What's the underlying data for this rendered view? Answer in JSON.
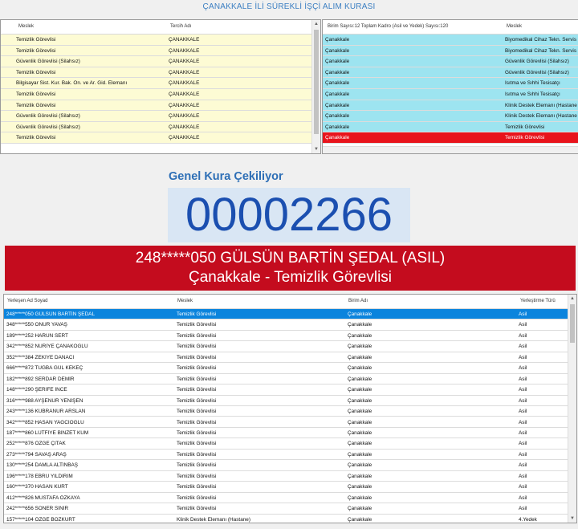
{
  "window": {
    "title": "ÇANAKKALE İLİ SÜREKLİ İŞÇİ ALIM KURASI"
  },
  "top_left_grid": {
    "columns": [
      "Meslek",
      "Tercih Adı"
    ],
    "rows": [
      [
        "Temizlik Görevlisi",
        "ÇANAKKALE"
      ],
      [
        "Temizlik Görevlisi",
        "ÇANAKKALE"
      ],
      [
        "Güvenlik Görevlisi (Silahsız)",
        "ÇANAKKALE"
      ],
      [
        "Temizlik Görevlisi",
        "ÇANAKKALE"
      ],
      [
        "Bilgisayar Sist. Kur. Bak. On. ve Ar. Gid. Elemanı",
        "ÇANAKKALE"
      ],
      [
        "Temizlik Görevlisi",
        "ÇANAKKALE"
      ],
      [
        "Temizlik Görevlisi",
        "ÇANAKKALE"
      ],
      [
        "Güvenlik Görevlisi (Silahsız)",
        "ÇANAKKALE"
      ],
      [
        "Güvenlik Görevlisi (Silahsız)",
        "ÇANAKKALE"
      ],
      [
        "Temizlik Görevlisi",
        "ÇANAKKALE"
      ]
    ]
  },
  "top_right_grid": {
    "columns": [
      "Birim Sayısı:12 Toplam Kadro (Asil ve Yedek) Sayısı:120",
      "Meslek"
    ],
    "rows": [
      [
        "Çanakkale",
        "Biyomedikal Cihaz Tekn. Servis"
      ],
      [
        "Çanakkale",
        "Biyomedikal Cihaz Tekn. Servis"
      ],
      [
        "Çanakkale",
        "Güvenlik Görevlisi (Silahsız)"
      ],
      [
        "Çanakkale",
        "Güvenlik Görevlisi (Silahsız)"
      ],
      [
        "Çanakkale",
        "Isıtma ve Sıhhi Tesisatçı"
      ],
      [
        "Çanakkale",
        "Isıtma ve Sıhhi Tesisatçı"
      ],
      [
        "Çanakkale",
        "Klinik Destek Elemanı (Hastane"
      ],
      [
        "Çanakkale",
        "Klinik Destek Elemanı (Hastane"
      ],
      [
        "Çanakkale",
        "Temizlik Görevlisi"
      ],
      [
        "Çanakkale",
        "Temizlik Görevlisi"
      ]
    ],
    "selected_row": 9
  },
  "draw": {
    "label": "Genel Kura Çekiliyor",
    "number": "00002266",
    "winner_line1": "248*****050 GÜLSÜN BARTİN ŞEDAL (ASIL)",
    "winner_line2": "Çanakkale - Temizlik Görevlisi"
  },
  "results_grid": {
    "columns": [
      "Yerleşen Ad Soyad",
      "Meslek",
      "Birim Adı",
      "Yerleştirme Türü"
    ],
    "rows": [
      [
        "248*****050 GÜLSÜN BARTİN ŞEDAL",
        "Temizlik Görevlisi",
        "Çanakkale",
        "Asil"
      ],
      [
        "348*****550 ONUR YAVAŞ",
        "Temizlik Görevlisi",
        "Çanakkale",
        "Asil"
      ],
      [
        "189*****252 HARUN SERT",
        "Temizlik Görevlisi",
        "Çanakkale",
        "Asil"
      ],
      [
        "342*****852 NURİYE ÇANAKOĞLU",
        "Temizlik Görevlisi",
        "Çanakkale",
        "Asil"
      ],
      [
        "352*****384 ZEKİYE DANACI",
        "Temizlik Görevlisi",
        "Çanakkale",
        "Asil"
      ],
      [
        "666*****872 TUĞBA GÜL KEKEÇ",
        "Temizlik Görevlisi",
        "Çanakkale",
        "Asil"
      ],
      [
        "182*****892 SERDAR DEMİR",
        "Temizlik Görevlisi",
        "Çanakkale",
        "Asil"
      ],
      [
        "148*****290 ŞERİFE İNCE",
        "Temizlik Görevlisi",
        "Çanakkale",
        "Asil"
      ],
      [
        "316*****988 AYŞENUR YENİŞEN",
        "Temizlik Görevlisi",
        "Çanakkale",
        "Asil"
      ],
      [
        "243*****136 KÜBRANUR ARSLAN",
        "Temizlik Görevlisi",
        "Çanakkale",
        "Asil"
      ],
      [
        "342*****852 HASAN YAĞCIOĞLU",
        "Temizlik Görevlisi",
        "Çanakkale",
        "Asil"
      ],
      [
        "187*****860 LÜTFİYE BİNZET KUM",
        "Temizlik Görevlisi",
        "Çanakkale",
        "Asil"
      ],
      [
        "252*****876 ÖZGE ÇITAK",
        "Temizlik Görevlisi",
        "Çanakkale",
        "Asil"
      ],
      [
        "273*****794 SAVAŞ ARAŞ",
        "Temizlik Görevlisi",
        "Çanakkale",
        "Asil"
      ],
      [
        "130*****254 DAMLA ALTINBAŞ",
        "Temizlik Görevlisi",
        "Çanakkale",
        "Asil"
      ],
      [
        "196*****178 EBRU YILDIRIM",
        "Temizlik Görevlisi",
        "Çanakkale",
        "Asil"
      ],
      [
        "160*****370 HASAN KURT",
        "Temizlik Görevlisi",
        "Çanakkale",
        "Asil"
      ],
      [
        "412*****826 MUSTAFA ÖZKAYA",
        "Temizlik Görevlisi",
        "Çanakkale",
        "Asil"
      ],
      [
        "242*****656 SONER SİNİR",
        "Temizlik Görevlisi",
        "Çanakkale",
        "Asil"
      ],
      [
        "157*****104 ÖZGE BOZKURT",
        "Klinik Destek Elemanı (Hastane)",
        "Çanakkale",
        "4.Yedek"
      ]
    ],
    "selected_row": 0
  },
  "colors": {
    "top_left_row_bg": "#fdfbd4",
    "top_right_row_bg": "#9de4f0",
    "top_right_selected_bg": "#e8141c",
    "results_selected_bg": "#0b84dd",
    "banner_bg": "#c40c1e",
    "number_box_bg": "#d9e6f4"
  },
  "icons": {
    "scroll_up": "▲",
    "scroll_down": "▼",
    "scroll_left": "◀",
    "scroll_right": "▶"
  }
}
